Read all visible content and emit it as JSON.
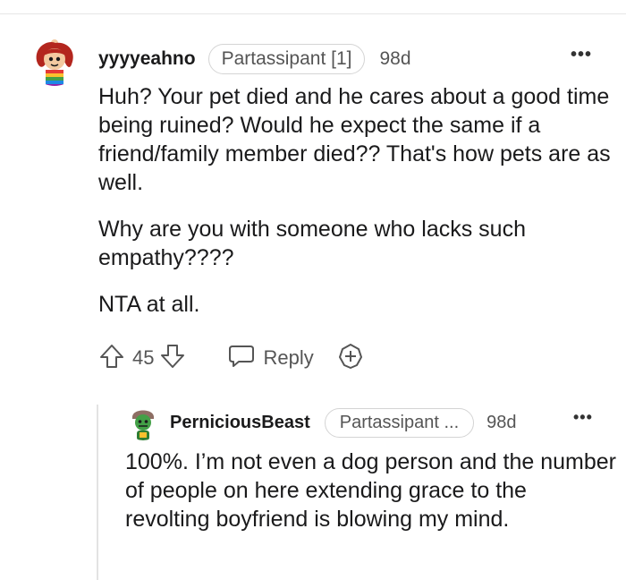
{
  "comment": {
    "username": "yyyyeahno",
    "flair": "Partassipant [1]",
    "age": "98d",
    "more": "•••",
    "paragraphs": [
      "Huh? Your pet died and he cares about a good time being ruined? Would he expect the same if a friend/family member died?? That's how pets are as well.",
      "Why are you with someone who lacks such empathy????",
      "NTA at all."
    ],
    "score": "45",
    "reply_label": "Reply",
    "icons": {
      "upvote": "upvote-arrow-icon",
      "downvote": "downvote-arrow-icon",
      "reply": "speech-bubble-icon",
      "award": "award-plus-icon"
    }
  },
  "reply": {
    "username": "PerniciousBeast",
    "flair": "Partassipant ...",
    "age": "98d",
    "more": "•••",
    "paragraphs": [
      "100%. I’m not even a dog person and the number of people on here extending grace to the revolting boyfriend is blowing my mind."
    ]
  },
  "colors": {
    "text": "#1a1a1b",
    "meta": "#555555",
    "divider": "#e6e6e6",
    "thread_line": "#e3e3e3"
  }
}
